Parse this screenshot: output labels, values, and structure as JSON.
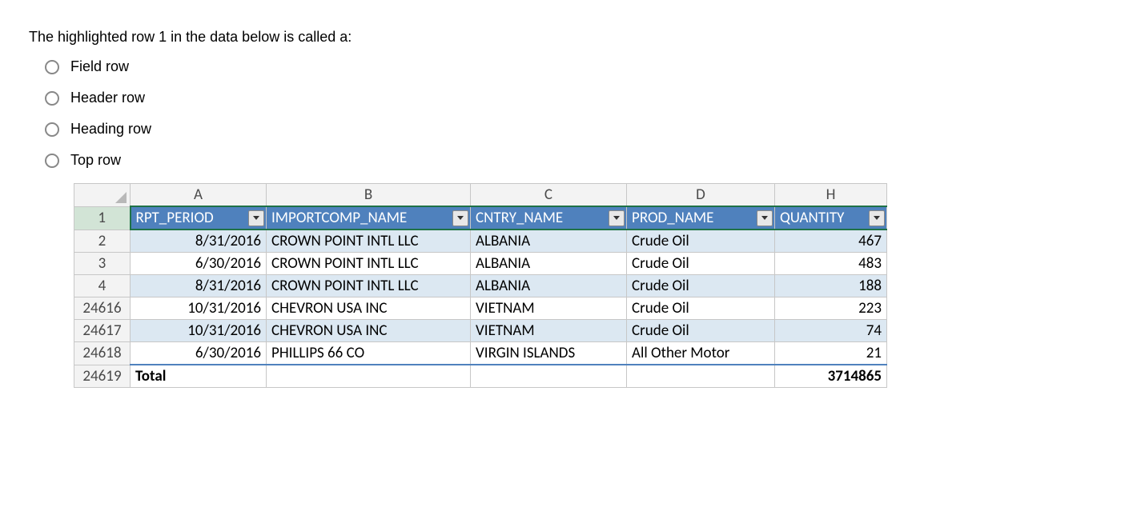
{
  "question": "The highlighted row 1 in the data below is called a:",
  "options": [
    {
      "label": "Field row"
    },
    {
      "label": "Header row"
    },
    {
      "label": "Heading row"
    },
    {
      "label": "Top row"
    }
  ],
  "spreadsheet": {
    "col_letters": [
      "A",
      "B",
      "C",
      "D",
      "H"
    ],
    "header_row_num": "1",
    "headers": [
      "RPT_PERIOD",
      "IMPORTCOMP_NAME",
      "CNTRY_NAME",
      "PROD_NAME",
      "QUANTITY"
    ],
    "rows": [
      {
        "num": "2",
        "band": true,
        "cells": [
          "8/31/2016",
          "CROWN POINT INTL LLC",
          "ALBANIA",
          "Crude Oil",
          "467"
        ]
      },
      {
        "num": "3",
        "band": false,
        "cells": [
          "6/30/2016",
          "CROWN POINT INTL LLC",
          "ALBANIA",
          "Crude Oil",
          "483"
        ]
      },
      {
        "num": "4",
        "band": true,
        "cells": [
          "8/31/2016",
          "CROWN POINT INTL LLC",
          "ALBANIA",
          "Crude Oil",
          "188"
        ]
      },
      {
        "num": "24616",
        "band": false,
        "cells": [
          "10/31/2016",
          "CHEVRON USA INC",
          "VIETNAM",
          "Crude Oil",
          "223"
        ]
      },
      {
        "num": "24617",
        "band": true,
        "cells": [
          "10/31/2016",
          "CHEVRON USA INC",
          "VIETNAM",
          "Crude Oil",
          "74"
        ]
      },
      {
        "num": "24618",
        "band": false,
        "cells": [
          "6/30/2016",
          "PHILLIPS 66 CO",
          "VIRGIN ISLANDS",
          "All Other Motor",
          "21"
        ]
      }
    ],
    "total_row": {
      "num": "24619",
      "label": "Total",
      "quantity": "3714865"
    }
  }
}
